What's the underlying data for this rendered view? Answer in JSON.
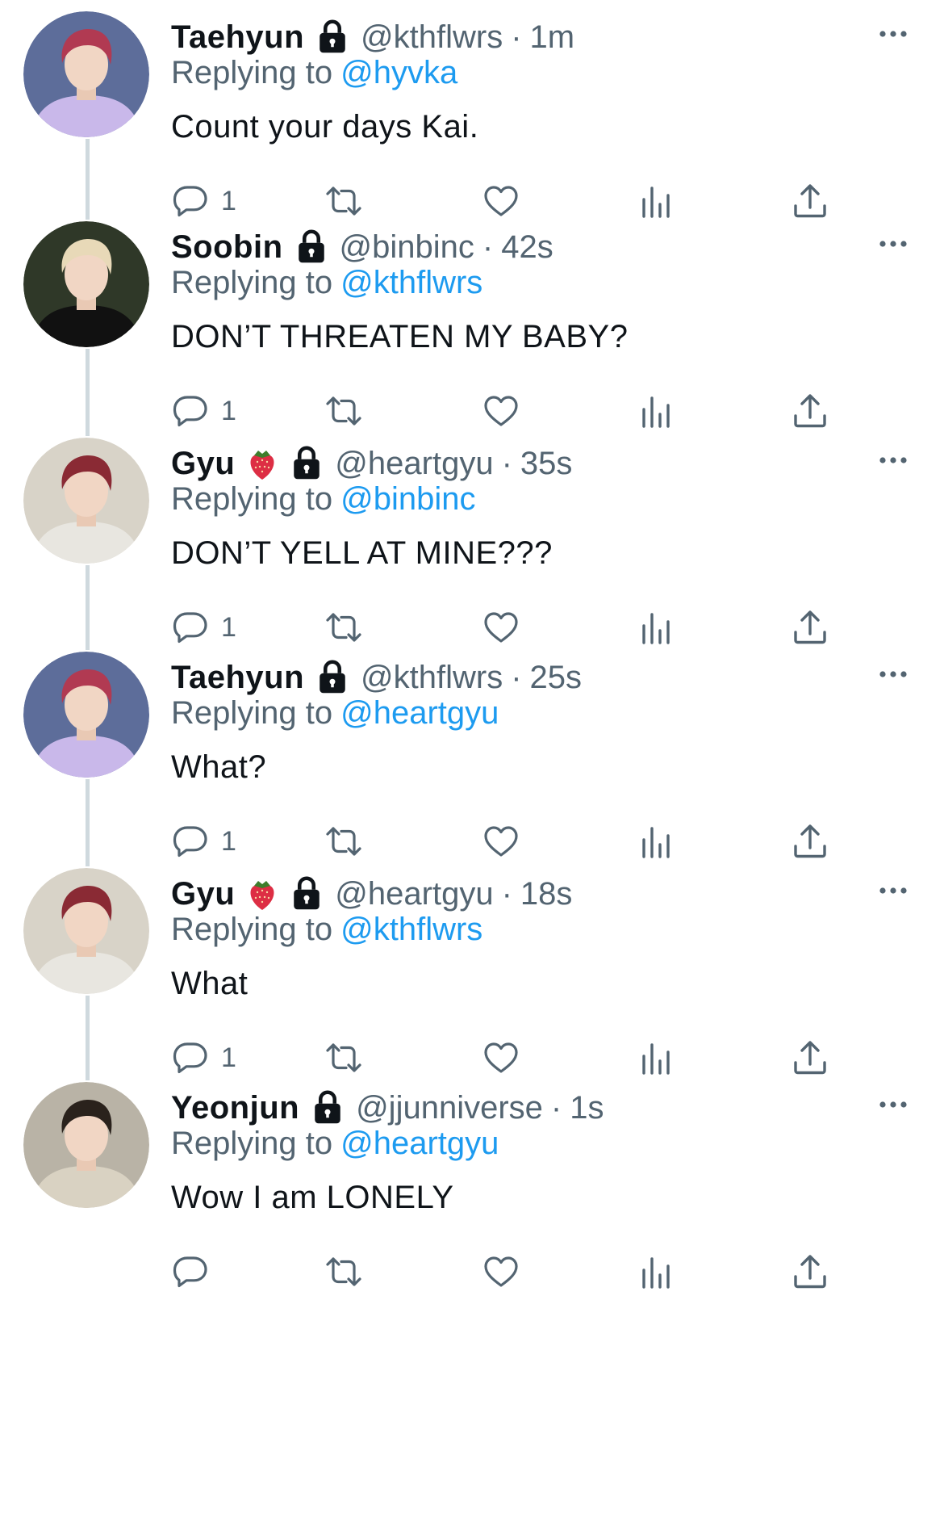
{
  "replying_prefix": "Replying to",
  "tweets": [
    {
      "name": "Taehyun",
      "emoji": "",
      "handle": "@kthflwrs",
      "separator": "·",
      "time": "1m",
      "reply_to": "@hyvka",
      "text": "Count your days Kai.",
      "reply_count": "1",
      "avatar": {
        "icon": "avatar-red-hair-purple-shirt",
        "bg": "#5d6d9a",
        "hair": "#b13a52",
        "shirt": "#c9b8ea"
      }
    },
    {
      "name": "Soobin",
      "emoji": "",
      "handle": "@binbinc",
      "separator": "·",
      "time": "42s",
      "reply_to": "@kthflwrs",
      "text": "DON’T THREATEN MY BABY?",
      "reply_count": "1",
      "avatar": {
        "icon": "avatar-black-hoodie-night",
        "bg": "#2f3828",
        "hair": "#e8d9b8",
        "shirt": "#111111"
      }
    },
    {
      "name": "Gyu",
      "emoji": "strawberry-icon",
      "handle": "@heartgyu",
      "separator": "·",
      "time": "35s",
      "reply_to": "@binbinc",
      "text": "DON’T YELL AT MINE???",
      "reply_count": "1",
      "avatar": {
        "icon": "avatar-red-hair-white-shirt",
        "bg": "#d8d3c8",
        "hair": "#8a2a34",
        "shirt": "#e8e6e0"
      }
    },
    {
      "name": "Taehyun",
      "emoji": "",
      "handle": "@kthflwrs",
      "separator": "·",
      "time": "25s",
      "reply_to": "@heartgyu",
      "text": "What?",
      "reply_count": "1",
      "avatar": {
        "icon": "avatar-red-hair-purple-shirt",
        "bg": "#5d6d9a",
        "hair": "#b13a52",
        "shirt": "#c9b8ea"
      }
    },
    {
      "name": "Gyu",
      "emoji": "strawberry-icon",
      "handle": "@heartgyu",
      "separator": "·",
      "time": "18s",
      "reply_to": "@kthflwrs",
      "text": "What",
      "reply_count": "1",
      "avatar": {
        "icon": "avatar-red-hair-white-shirt",
        "bg": "#d8d3c8",
        "hair": "#8a2a34",
        "shirt": "#e8e6e0"
      }
    },
    {
      "name": "Yeonjun",
      "emoji": "",
      "handle": "@jjunniverse",
      "separator": "·",
      "time": "1s",
      "reply_to": "@heartgyu",
      "text": "Wow I am LONELY",
      "reply_count": "",
      "avatar": {
        "icon": "avatar-dark-hair-cream-sweater",
        "bg": "#b9b3a6",
        "hair": "#2a221c",
        "shirt": "#d9d2c2"
      }
    }
  ],
  "colors": {
    "text": "#0f1419",
    "secondary": "#536471",
    "link": "#1d9bf0",
    "thread_line": "#cfd9de"
  }
}
